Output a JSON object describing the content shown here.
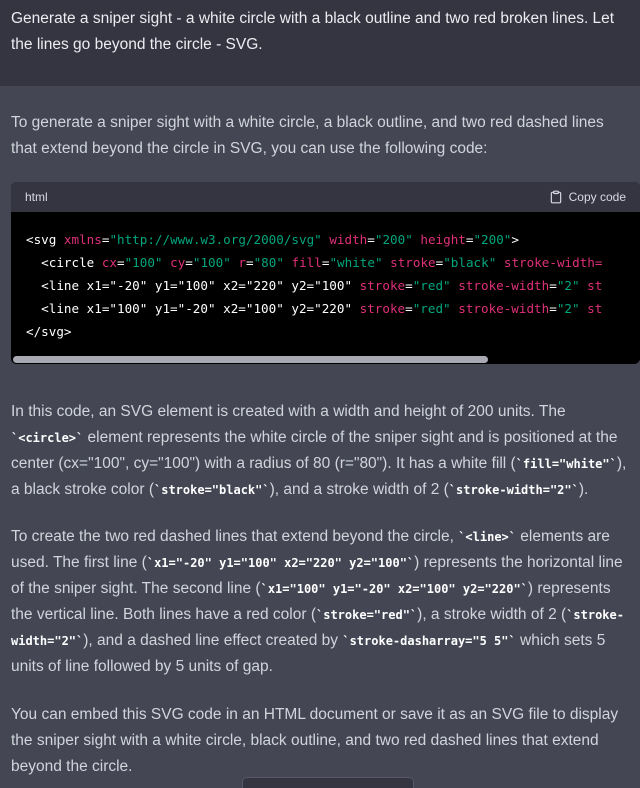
{
  "user": {
    "message": "Generate a sniper sight - a white circle with a black outline and two red broken lines. Let the lines go beyond the circle - SVG."
  },
  "assistant": {
    "intro": "To generate a sniper sight with a white circle, a black outline, and two red dashed lines that extend beyond the circle in SVG, you can use the following code:",
    "code_block": {
      "language": "html",
      "copy_label": "Copy code",
      "lines": [
        "<svg xmlns=\"http://www.w3.org/2000/svg\" width=\"200\" height=\"200\">",
        "  <circle cx=\"100\" cy=\"100\" r=\"80\" fill=\"white\" stroke=\"black\" stroke-width=",
        "  <line x1=\"-20\" y1=\"100\" x2=\"220\" y2=\"100\" stroke=\"red\" stroke-width=\"2\" st",
        "  <line x1=\"100\" y1=\"-20\" x2=\"100\" y2=\"220\" stroke=\"red\" stroke-width=\"2\" st",
        "</svg>"
      ]
    },
    "p2": {
      "t1": "In this code, an SVG element is created with a width and height of 200 units. The ",
      "c1": "`<circle>`",
      "t2": " element represents the white circle of the sniper sight and is positioned at the center (cx=\"100\", cy=\"100\") with a radius of 80 (r=\"80\"). It has a white fill (",
      "c2": "`fill=\"white\"`",
      "t3": "), a black stroke color (",
      "c3": "`stroke=\"black\"`",
      "t4": "), and a stroke width of 2 (",
      "c4": "`stroke-width=\"2\"`",
      "t5": ")."
    },
    "p3": {
      "t1": "To create the two red dashed lines that extend beyond the circle, ",
      "c1": "`<line>`",
      "t2": " elements are used. The first line (",
      "c2": "`x1=\"-20\" y1=\"100\" x2=\"220\" y2=\"100\"`",
      "t3": ") represents the horizontal line of the sniper sight. The second line (",
      "c3": "`x1=\"100\" y1=\"-20\" x2=\"100\" y2=\"220\"`",
      "t4": ") represents the vertical line. Both lines have a red color (",
      "c4": "`stroke=\"red\"`",
      "t5": "), a stroke width of 2 (",
      "c5": "`stroke-width=\"2\"`",
      "t6": "), and a dashed line effect created by ",
      "c6": "`stroke-dasharray=\"5 5\"`",
      "t7": " which sets 5 units of line followed by 5 units of gap."
    },
    "p4": "You can embed this SVG code in an HTML document or save it as an SVG file to display the sniper sight with a white circle, black outline, and two red dashed lines that extend beyond the circle."
  },
  "colors": {
    "page_bg": "#444654",
    "user_bg": "#343541",
    "code_bg": "#000000",
    "attr": "#df3079",
    "value": "#00a67d"
  },
  "icons": {
    "copy": "clipboard-icon"
  }
}
